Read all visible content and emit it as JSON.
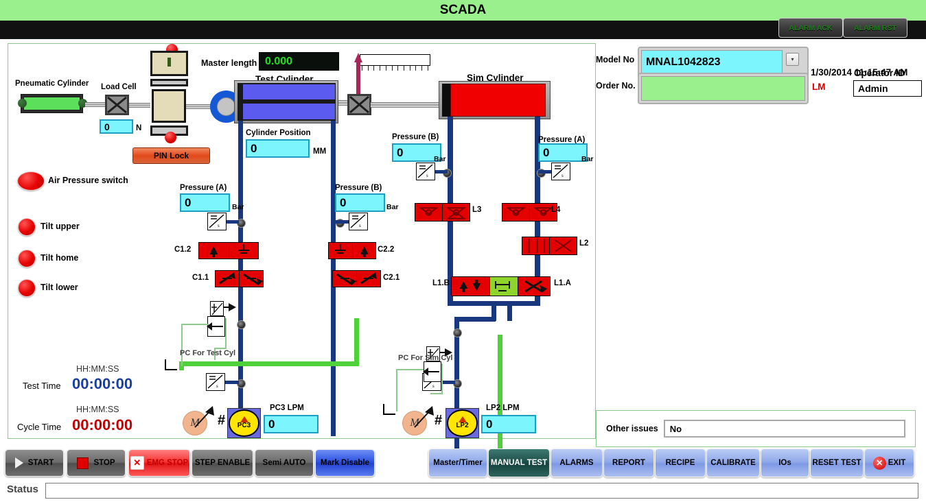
{
  "titlebar": {
    "title": "SCADA"
  },
  "alarms": {
    "ack_label": "ALARM ACK",
    "rst_label": "ALARM RST"
  },
  "header": {
    "model_label": "Model No",
    "model_value": "MNAL1042823",
    "order_label": "Order No.",
    "order_value": "",
    "datetime": "1/30/2014 11:15:47 AM",
    "lm": "LM",
    "operator_label": "Operator ID",
    "operator_value": "Admin",
    "dropdown_icon": "chevron-down-icon"
  },
  "diagram": {
    "master_length_label": "Master length",
    "master_length_value": "0.000",
    "pneumatic_label": "Pneumatic Cylinder",
    "load_cell_label": "Load Cell",
    "load_cell_value": "0",
    "load_cell_unit": "N",
    "pin_lock_label": "PIN Lock",
    "test_cylinder_title": "Test Cylinder",
    "sim_cylinder_title": "Sim Cylinder",
    "cylinder_position_label": "Cylinder Position",
    "cylinder_position_value": "0",
    "cylinder_position_unit": "MM",
    "indicators": [
      {
        "label": "Air Pressure switch",
        "color": "#e60000"
      },
      {
        "label": "Tilt upper",
        "color": "#e60000"
      },
      {
        "label": "Tilt home",
        "color": "#e60000"
      },
      {
        "label": "Tilt lower",
        "color": "#e60000"
      }
    ],
    "pressures": [
      {
        "id": "test-a",
        "label": "Pressure (A)",
        "value": "0",
        "unit": "Bar"
      },
      {
        "id": "test-b",
        "label": "Pressure (B)",
        "value": "0",
        "unit": "Bar"
      },
      {
        "id": "sim-b",
        "label": "Pressure (B)",
        "value": "0",
        "unit": "Bar"
      },
      {
        "id": "sim-a",
        "label": "Pressure (A)",
        "value": "0",
        "unit": "Bar"
      }
    ],
    "valve_tags": {
      "c1_2": "C1.2",
      "c1_1": "C1.1",
      "c2_2": "C2.2",
      "c2_1": "C2.1",
      "l3": "L3",
      "l4": "L4",
      "l2": "L2",
      "l1b": "L1.B",
      "l1a": "L1.A"
    },
    "pc_test_label": "PC For Test Cyl",
    "pc_sim_label": "PC For Sim Cyl",
    "pumps": [
      {
        "name": "PC3",
        "lpm_label": "PC3 LPM",
        "lpm_value": "0"
      },
      {
        "name": "LP2",
        "lpm_label": "LP2 LPM",
        "lpm_value": "0"
      }
    ],
    "motor_glyph": "M",
    "hash_glyph": "#",
    "timers": {
      "format_label": "HH:MM:SS",
      "test_time_label": "Test Time",
      "test_time_value": "00:00:00",
      "test_time_color": "#1b3fa0",
      "cycle_time_label": "Cycle Time",
      "cycle_time_value": "00:00:00",
      "cycle_time_color": "#c40000"
    }
  },
  "issues": {
    "label": "Other issues",
    "value": "No"
  },
  "left_buttons": [
    {
      "label": "START",
      "icon": "play-icon",
      "style": "gray"
    },
    {
      "label": "STOP",
      "icon": "stop-icon",
      "style": "gray"
    },
    {
      "label": "EMG STOP",
      "icon": "x-box-icon",
      "style": "red"
    },
    {
      "label": "STEP ENABLE",
      "icon": "",
      "style": "gray"
    },
    {
      "label": "Semi AUTO",
      "icon": "",
      "style": "gray"
    },
    {
      "label": "Mark Disable",
      "icon": "",
      "style": "blue"
    }
  ],
  "right_buttons": [
    {
      "label": "Master/Timer",
      "style": "lblue",
      "icon": ""
    },
    {
      "label": "MANUAL TEST",
      "style": "active",
      "icon": ""
    },
    {
      "label": "ALARMS",
      "style": "lblue",
      "icon": ""
    },
    {
      "label": "REPORT",
      "style": "lblue",
      "icon": ""
    },
    {
      "label": "RECIPE",
      "style": "lblue",
      "icon": ""
    },
    {
      "label": "CALIBRATE",
      "style": "lblue",
      "icon": ""
    },
    {
      "label": "IOs",
      "style": "lblue",
      "icon": ""
    },
    {
      "label": "RESET TEST",
      "style": "lblue",
      "icon": ""
    },
    {
      "label": "EXIT",
      "style": "lblue",
      "icon": "x-circle-icon"
    }
  ],
  "statusbar": {
    "label": "Status",
    "value": ""
  },
  "colors": {
    "title_green": "#9bf08e",
    "value_cyan": "#7df5fd",
    "valve_red": "#e50000",
    "valve_green": "#8fd42a",
    "pipe_blue": "#19377f",
    "pipe_green": "#4fd13a",
    "sim_red": "#f10000",
    "test_blue": "#5b5bef"
  }
}
